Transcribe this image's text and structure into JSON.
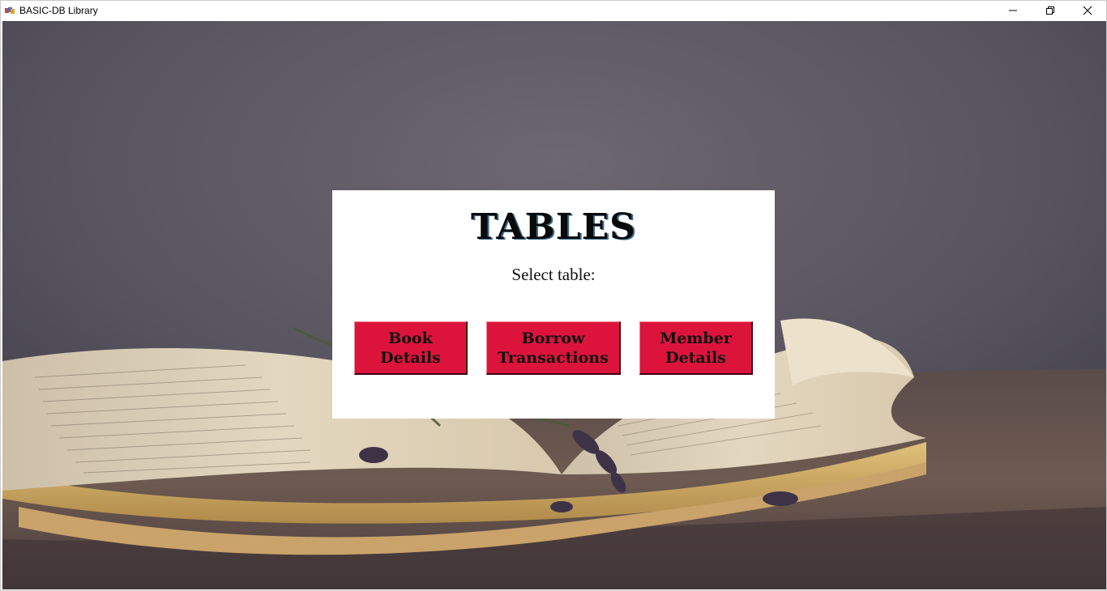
{
  "window": {
    "title": "BASIC-DB Library",
    "controls": [
      "minimize-icon",
      "restore-icon",
      "close-icon"
    ]
  },
  "panel": {
    "title": "TABLES",
    "subtitle": "Select table:"
  },
  "buttons": {
    "book": {
      "line1": "Book",
      "line2": "Details"
    },
    "borrow": {
      "line1": "Borrow",
      "line2": "Transactions"
    },
    "member": {
      "line1": "Member",
      "line2": "Details"
    }
  },
  "colors": {
    "button_bg": "#dc143c",
    "panel_bg": "#ffffff",
    "backdrop": "#5f5c66"
  },
  "background": {
    "description_icon": "open-book-photo"
  }
}
